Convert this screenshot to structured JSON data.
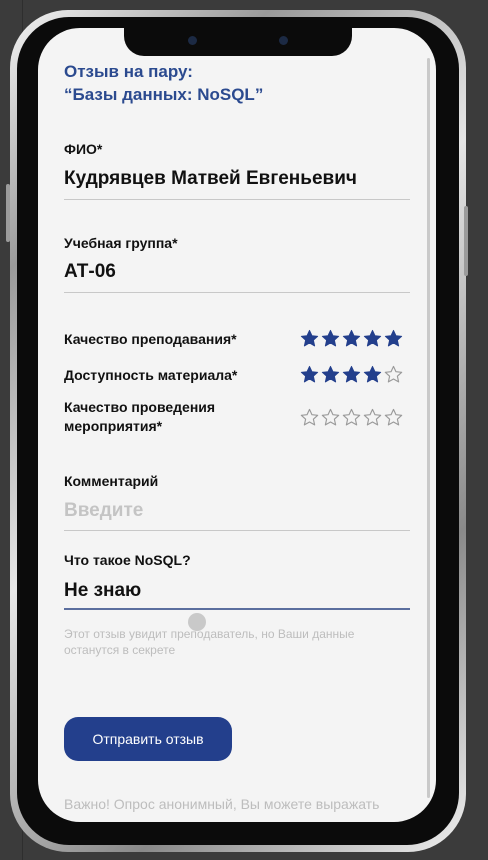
{
  "form": {
    "title_line1": "Отзыв на пару:",
    "title_line2": "“Базы данных: NoSQL”",
    "fio_label": "ФИО*",
    "fio_value": "Кудрявцев Матвей Евгеньевич",
    "group_label": "Учебная группа*",
    "group_value": "АТ-06",
    "ratings": [
      {
        "label_line1": "Качество преподавания*",
        "label_line2": "",
        "stars": 5
      },
      {
        "label_line1": "Доступность материала*",
        "label_line2": "",
        "stars": 4
      },
      {
        "label_line1": "Качество проведения",
        "label_line2": "мероприятия*",
        "stars": 0
      }
    ],
    "comment_label": "Комментарий",
    "comment_placeholder": "Введите",
    "question_label": "Что такое NoSQL?",
    "question_value": "Не знаю",
    "privacy_note": "Этот отзыв увидит преподаватель, но Ваши данные останутся в секрете",
    "submit_label": "Отправить отзыв",
    "important_note": "Важно! Опрос анонимный, Вы можете выражать"
  },
  "colors": {
    "accent": "#233f8c",
    "title": "#2b4a8f",
    "star": "#233f8c"
  }
}
